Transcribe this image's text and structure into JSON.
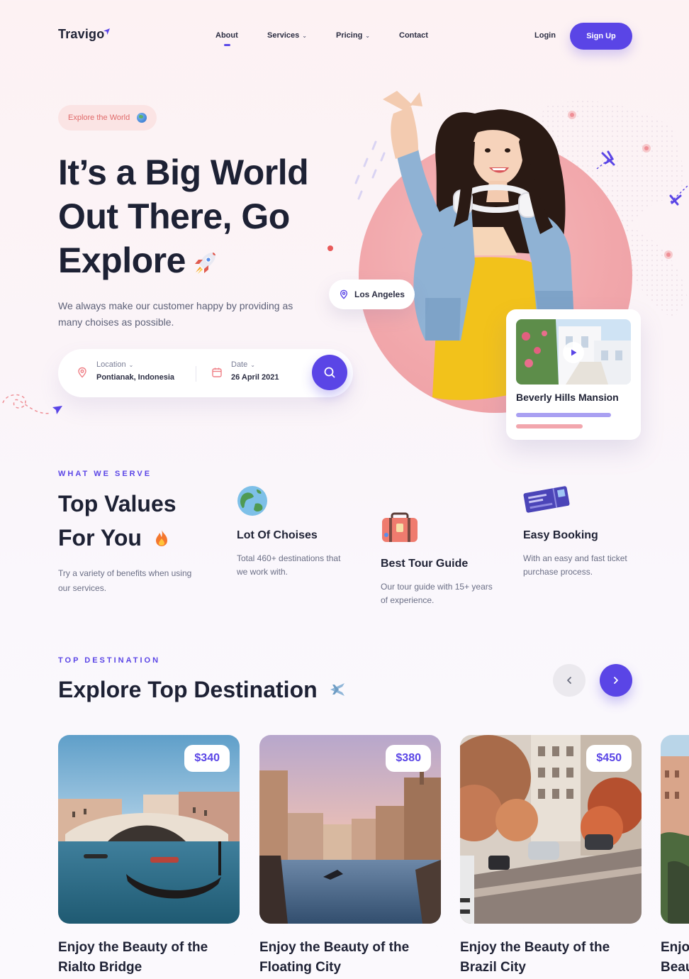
{
  "nav": {
    "logo": "Travigo",
    "links": [
      {
        "label": "About"
      },
      {
        "label": "Services"
      },
      {
        "label": "Pricing"
      },
      {
        "label": "Contact"
      }
    ],
    "login": "Login",
    "signup": "Sign Up"
  },
  "hero": {
    "badge": "Explore the World",
    "title_lines": [
      "It’s a Big World",
      "Out There, Go",
      "Explore"
    ],
    "subtitle": "We always make our customer happy by providing as many choises as possible.",
    "search": {
      "location_label": "Location",
      "location_value": "Pontianak, Indonesia",
      "date_label": "Date",
      "date_value": "26 April 2021"
    },
    "location_pill": "Los Angeles",
    "card_title": "Beverly Hills Mansion"
  },
  "services": {
    "eyebrow": "WHAT WE SERVE",
    "title_lines": [
      "Top Values",
      "For You"
    ],
    "subtitle": "Try a variety of benefits when using our services.",
    "features": [
      {
        "title": "Lot Of Choises",
        "desc": "Total 460+ destinations that we work with."
      },
      {
        "title": "Best Tour Guide",
        "desc": "Our tour guide with 15+ years of experience."
      },
      {
        "title": "Easy Booking",
        "desc": "With an easy and fast ticket purchase process."
      }
    ]
  },
  "destinations": {
    "eyebrow": "TOP DESTINATION",
    "title": "Explore Top Destination",
    "cards": [
      {
        "price": "$340",
        "title": "Enjoy the Beauty of the Rialto Bridge"
      },
      {
        "price": "$380",
        "title": "Enjoy the Beauty of the Floating City"
      },
      {
        "price": "$450",
        "title": "Enjoy the Beauty of the Brazil City"
      },
      {
        "price": "",
        "title": "Enjo Beau"
      }
    ]
  },
  "colors": {
    "accent": "#5a45e6",
    "pink": "#f2a6ad",
    "dark": "#1d2134"
  }
}
